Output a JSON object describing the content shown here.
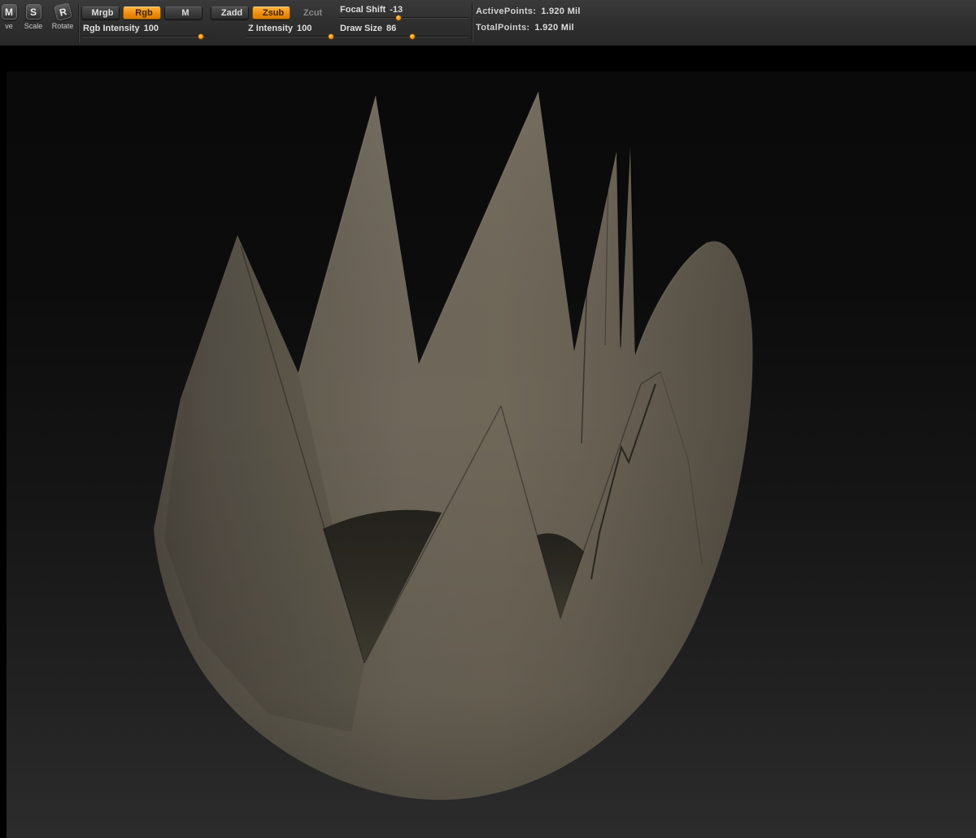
{
  "toolbar": {
    "tools": [
      {
        "icon": "M",
        "label": "ve"
      },
      {
        "icon": "S",
        "label": "Scale"
      },
      {
        "icon": "R",
        "label": "Rotate"
      }
    ],
    "buttons": [
      {
        "label": "Mrgb",
        "state": "normal"
      },
      {
        "label": "Rgb",
        "state": "active"
      },
      {
        "label": "M",
        "state": "normal"
      },
      {
        "label": "Zadd",
        "state": "normal"
      },
      {
        "label": "Zsub",
        "state": "active"
      },
      {
        "label": "Zcut",
        "state": "disabled"
      }
    ],
    "sliders": [
      {
        "label": "Focal Shift",
        "value": "-13",
        "pos_pct": "46%"
      },
      {
        "label": "Rgb Intensity",
        "value": "100",
        "pos_pct": "95%"
      },
      {
        "label": "Z Intensity",
        "value": "100",
        "pos_pct": "92%"
      },
      {
        "label": "Draw Size",
        "value": "86",
        "pos_pct": "57%"
      }
    ],
    "stats": [
      {
        "label": "ActivePoints:",
        "value": "1.920  Mil"
      },
      {
        "label": "TotalPoints:",
        "value": "1.920  Mil"
      }
    ]
  },
  "canvas": {
    "object": "crown-shaped sculpted mesh with zigzag cut rim"
  },
  "colors": {
    "accent_orange": "#f29413",
    "toolbar_bg": "#313131",
    "canvas_top": "#0a0a0a",
    "canvas_bottom": "#2c2c2c",
    "mesh_base": "#6e675a",
    "mesh_dark_side": "#4e4940",
    "mesh_interior": "#2e2b24"
  }
}
